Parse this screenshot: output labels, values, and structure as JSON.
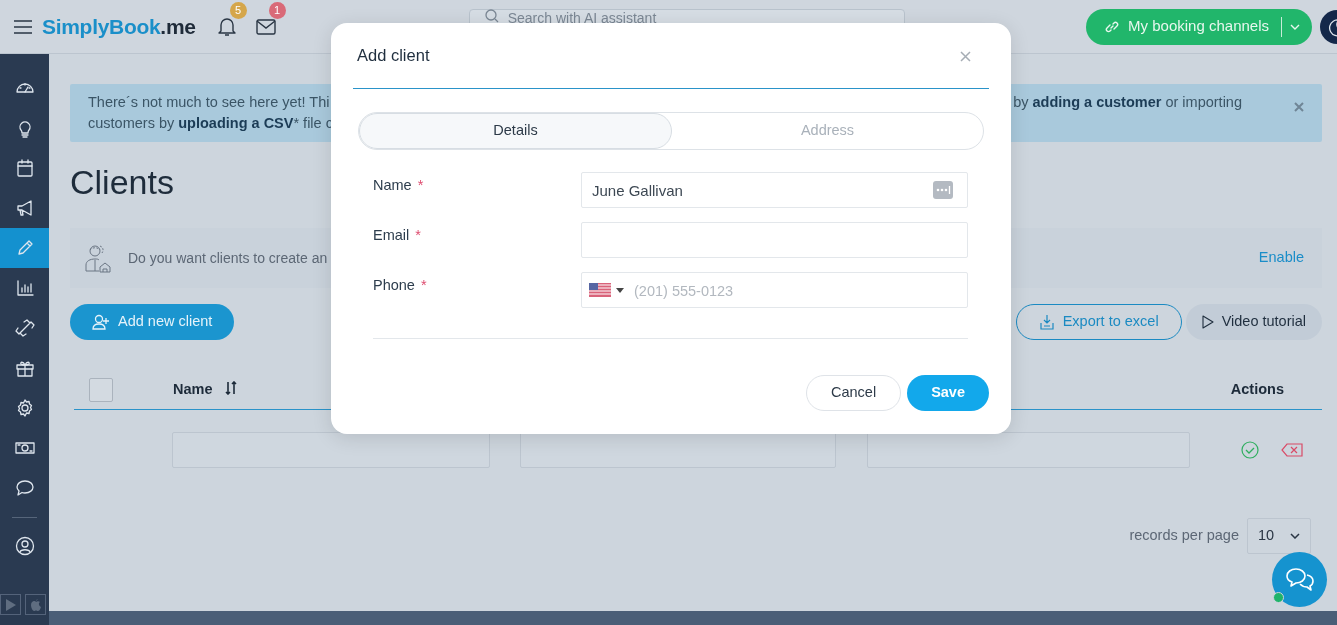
{
  "topbar": {
    "logo": [
      "SimplyBook",
      ".me"
    ],
    "notifications": {
      "count": "5"
    },
    "messages": {
      "count": "1"
    },
    "search": {
      "placeholder": "Search with AI assistant"
    },
    "booking_button": {
      "label": "My booking channels"
    }
  },
  "sidebar": {
    "items": [
      {
        "selected": false
      },
      {
        "selected": false
      },
      {
        "selected": false
      },
      {
        "selected": false
      },
      {
        "selected": true
      },
      {
        "selected": false
      },
      {
        "selected": false
      },
      {
        "selected": false
      },
      {
        "selected": false
      },
      {
        "selected": false
      },
      {
        "selected": false
      }
    ]
  },
  "banner": {
    "left_lines": [
      [
        {
          "text": "There´s not much to see here yet! Thi",
          "bold": false
        }
      ],
      [
        {
          "text": "customers by ",
          "bold": false
        },
        {
          "text": "uploading a CSV",
          "bold": true
        },
        {
          "text": "* file c",
          "bold": false
        }
      ]
    ],
    "right_lines": [
      [
        {
          "text": "by ",
          "bold": false
        },
        {
          "text": "adding a customer",
          "bold": true
        },
        {
          "text": " or importing",
          "bold": false
        }
      ]
    ]
  },
  "page_title": "Clients",
  "info_panel": {
    "text": "Do you want clients to create an",
    "link": "Enable"
  },
  "actions": {
    "add": "Add new client",
    "export": "Export to excel",
    "video": "Video tutorial"
  },
  "table": {
    "select_all": {
      "checked": false
    },
    "columns": [
      {
        "label": "Name",
        "sortable": true
      },
      {
        "label": "Actions",
        "sortable": false
      }
    ]
  },
  "pagination": {
    "label": "records per page",
    "per_page": "10"
  },
  "modal": {
    "title": "Add client",
    "tabs": [
      {
        "label": "Details",
        "selected": true
      },
      {
        "label": "Address",
        "selected": false
      }
    ],
    "fields": [
      {
        "label": "Name",
        "required_mark": "*",
        "kind": "text",
        "value": "June Gallivan",
        "autofill_icon": true
      },
      {
        "label": "Email",
        "required_mark": "*",
        "kind": "text"
      },
      {
        "label": "Phone",
        "required_mark": "*",
        "kind": "phone",
        "placeholder": "(201) 555-0123"
      }
    ],
    "buttons": [
      {
        "label": "Cancel",
        "kind": "secondary"
      },
      {
        "label": "Save",
        "kind": "primary"
      }
    ]
  }
}
